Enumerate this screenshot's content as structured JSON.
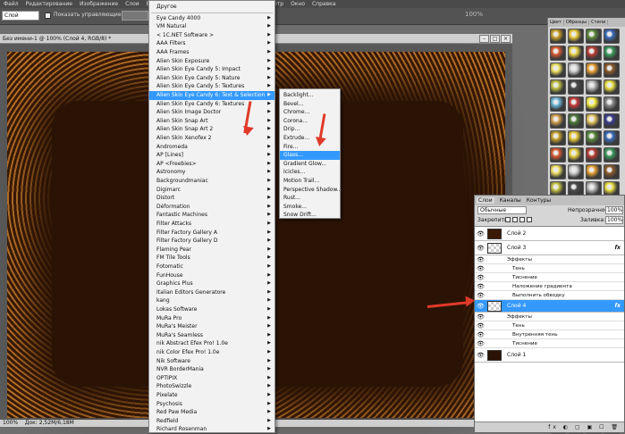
{
  "menubar": {
    "items": [
      "Файл",
      "Редактирование",
      "Изображение",
      "Слои",
      "Выделение",
      "Фильтр",
      "Анализ",
      "3D",
      "Просмотр",
      "Окно",
      "Справка"
    ]
  },
  "options": {
    "layer_select": "Слой",
    "show_controls_label": "Показать управляющие элементы",
    "zoom": "100%"
  },
  "document": {
    "tab_title": "Без имени-1 @ 100% (Слой 4, RGB/8) *",
    "status": "100%",
    "doc_size": "Док: 2,52M/6,18M"
  },
  "filter_menu": {
    "items": [
      "Другое",
      "Eye Candy 4000",
      "VM Natural",
      "< 1C.NET Software >",
      "AAA Filters",
      "AAA Frames",
      "Alien Skin Exposure",
      "Alien Skin Eye Candy 5: Impact",
      "Alien Skin Eye Candy 5: Nature",
      "Alien Skin Eye Candy 5: Textures",
      "Alien Skin Eye Candy 6: Text & Selection",
      "Alien Skin Eye Candy 6: Textures",
      "Alien Skin Image Doctor",
      "Alien Skin Snap Art",
      "Alien Skin Snap Art 2",
      "Alien Skin Xenofex 2",
      "Andromeda",
      "AP [Lines]",
      "AP <Freebies>",
      "Astronomy",
      "Backgroundmaniac",
      "Digimarc",
      "Distort",
      "Déformation",
      "Fantastic Machines",
      "Filter Attacks",
      "Filter Factory Gallery A",
      "Filter Factory Gallery D",
      "Flaming Pear",
      "FM Tile Tools",
      "Fotomatic",
      "FunHouse",
      "Graphics Plus",
      "Italian Editors Generatore",
      "kang",
      "Lokas Software",
      "MuRa Pro",
      "MuRa's Meister",
      "MuRa's Seamless",
      "nik Abstract Efex Pro! 1.0e",
      "nik Color Efex Pro! 1.0e",
      "Nik Software",
      "NVR BorderMania",
      "OPTIPIX",
      "PhotoSwizzle",
      "Pixelate",
      "Psychosis",
      "Red Paw Media",
      "Redfield",
      "Richard Rosenman"
    ],
    "selected_index": 10
  },
  "submenu": {
    "items": [
      "Backlight...",
      "Bevel...",
      "Chrome...",
      "Corona...",
      "Drip...",
      "Extrude...",
      "Fire...",
      "Glass...",
      "Gradient Glow...",
      "Icicles...",
      "Motion Trail...",
      "Perspective Shadow...",
      "Rust...",
      "Smoke...",
      "Snow Drift..."
    ],
    "selected_index": 7
  },
  "right_panel": {
    "tabs": [
      "Цвет",
      "Образцы",
      "Стили"
    ]
  },
  "layers_panel": {
    "tabs": [
      "Слои",
      "Каналы",
      "Контуры"
    ],
    "blend_mode": "Обычные",
    "opacity_label": "Непрозрачность:",
    "opacity_value": "100%",
    "lock_label": "Закрепить:",
    "fill_label": "Заливка:",
    "fill_value": "100%",
    "layers": [
      {
        "name": "Слой 2",
        "fx": ""
      },
      {
        "name": "Слой 3",
        "fx": "fx"
      },
      {
        "name": "Слой 4",
        "fx": "fx"
      },
      {
        "name": "Слой 1",
        "fx": ""
      }
    ],
    "layer3_effects": [
      "Эффекты",
      "Тень",
      "Тиснение",
      "Наложение градиента",
      "Выполнить обводку"
    ],
    "layer4_effects": [
      "Эффекты",
      "Тень",
      "Внутренняя тень",
      "Тиснение"
    ],
    "bottom_icons": "fx ◐ ▢ ▣ ☐ 🗑"
  },
  "colors": {
    "accent": "#3399ff",
    "arrow": "#e03a2a",
    "canvas_dark": "#2a1305",
    "canvas_gold": "#b8732a"
  }
}
